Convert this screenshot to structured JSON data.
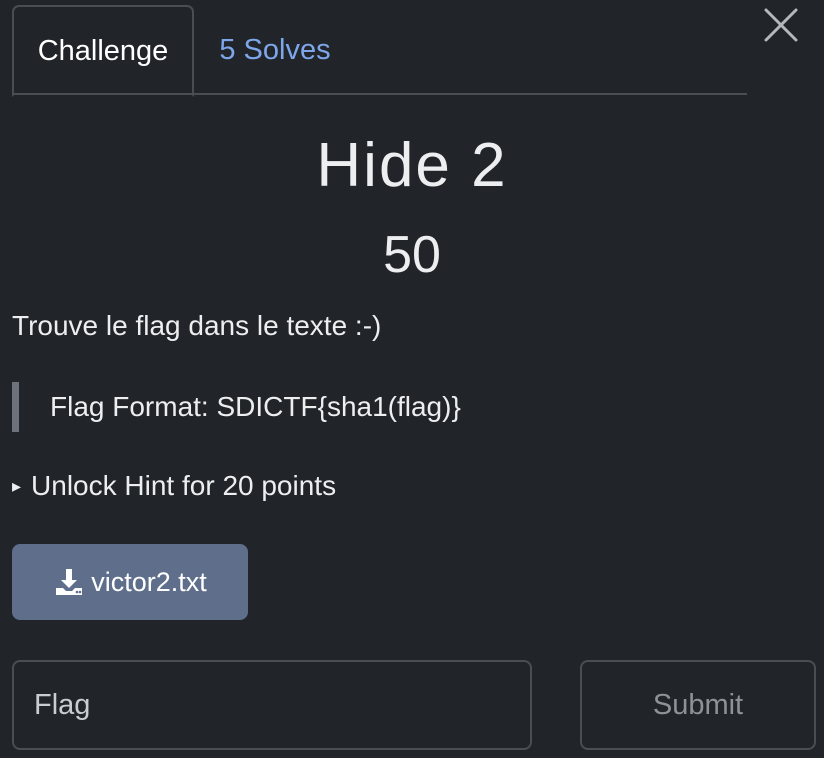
{
  "tabs": [
    {
      "label": "Challenge",
      "active": true
    },
    {
      "label": "5 Solves",
      "active": false
    }
  ],
  "close_icon": "close-icon",
  "challenge": {
    "name": "Hide 2",
    "value": "50",
    "description": "Trouve le flag dans le texte :-)",
    "blockquote": "Flag Format: SDICTF{sha1(flag)}",
    "hint_label": "Unlock Hint for 20 points",
    "hint_marker": "▸",
    "file": {
      "name": "victor2.txt",
      "icon": "download-icon"
    }
  },
  "submission": {
    "placeholder": "Flag",
    "value": "",
    "submit_label": "Submit"
  },
  "colors": {
    "background": "#212529",
    "tab_link": "#7ea6ea",
    "file_button": "#5f6f8b",
    "border": "#4a4e54"
  }
}
